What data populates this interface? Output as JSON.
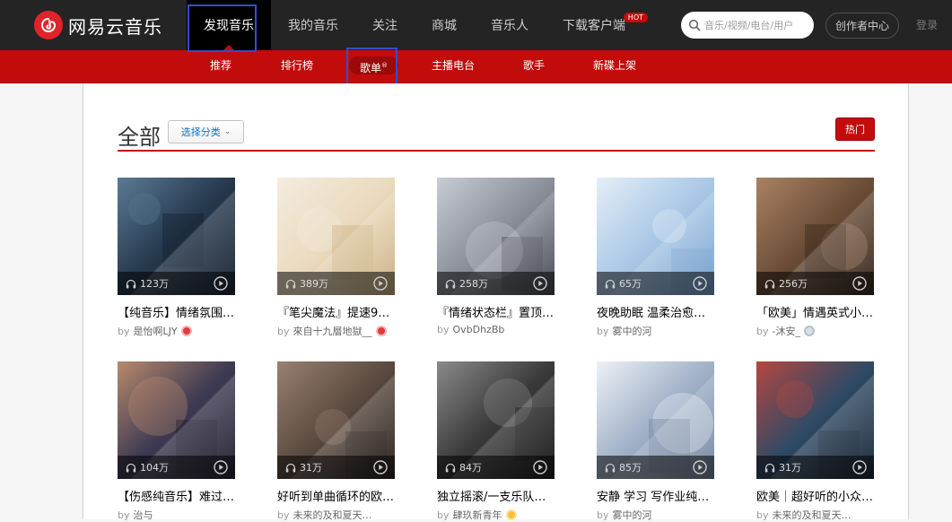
{
  "app": {
    "logo_text": "网易云音乐"
  },
  "nav": {
    "items": [
      {
        "label": "发现音乐"
      },
      {
        "label": "我的音乐"
      },
      {
        "label": "关注"
      },
      {
        "label": "商城"
      },
      {
        "label": "音乐人"
      },
      {
        "label": "下载客户端",
        "badge": "HOT"
      }
    ]
  },
  "search": {
    "placeholder": "音乐/视频/电台/用户"
  },
  "header_actions": {
    "creator_center": "创作者中心",
    "login": "登录"
  },
  "subnav": {
    "items": [
      {
        "label": "推荐"
      },
      {
        "label": "排行榜"
      },
      {
        "label": "歌单",
        "sup": "®"
      },
      {
        "label": "主播电台"
      },
      {
        "label": "歌手"
      },
      {
        "label": "新碟上架"
      }
    ]
  },
  "page": {
    "title": "全部",
    "category_button": "选择分类",
    "hot_button": "热门"
  },
  "playlists": [
    {
      "count": "123万",
      "title": "【纯音乐】情绪氛围…",
      "by": "by",
      "author": "是怡啊LJY",
      "badge": "red",
      "c1": "#25384c",
      "c2": "#0f1b29",
      "c3": "#5a7a95"
    },
    {
      "count": "389万",
      "title": "『笔尖魔法』提速9…",
      "by": "by",
      "author": "來自十九層地獄__",
      "badge": "red",
      "c1": "#eadbbd",
      "c2": "#c6a979",
      "c3": "#f4ece0"
    },
    {
      "count": "258万",
      "title": "『情绪状态栏』置顶…",
      "by": "by",
      "author": "OvbDhzBb",
      "badge": "",
      "c1": "#8a8f99",
      "c2": "#3b3f49",
      "c3": "#c8ccd3"
    },
    {
      "count": "65万",
      "title": "夜晚助眠 温柔治愈…",
      "by": "by",
      "author": "雾中的河",
      "badge": "",
      "c1": "#a9c8e6",
      "c2": "#6f9ccb",
      "c3": "#e5eef7"
    },
    {
      "count": "256万",
      "title": "「欧美」情遇英式小…",
      "by": "by",
      "author": "-沐安_",
      "badge": "gray",
      "c1": "#6b4d36",
      "c2": "#2b1d14",
      "c3": "#a98263"
    },
    {
      "count": "104万",
      "title": "【伤感纯音乐】难过…",
      "by": "by",
      "author": "治与",
      "badge": "",
      "c1": "#3d3a52",
      "c2": "#1a1826",
      "c3": "#b98a6c"
    },
    {
      "count": "31万",
      "title": "好听到单曲循环的欧…",
      "by": "by",
      "author": "未来的及和夏天…",
      "badge": "",
      "c1": "#5a4a40",
      "c2": "#1e1612",
      "c3": "#9a8070"
    },
    {
      "count": "84万",
      "title": "独立摇滚/一支乐队…",
      "by": "by",
      "author": "肆玖新青年",
      "badge": "gold",
      "c1": "#3a3a3a",
      "c2": "#111111",
      "c3": "#8a8a8a"
    },
    {
      "count": "85万",
      "title": "安静 学习 写作业纯…",
      "by": "by",
      "author": "雾中的河",
      "badge": "",
      "c1": "#9fb0c7",
      "c2": "#6c7f9b",
      "c3": "#eef1f5"
    },
    {
      "count": "31万",
      "title": "欧美｜超好听的小众…",
      "by": "by",
      "author": "未来的及和夏天…",
      "badge": "",
      "c1": "#2f4a66",
      "c2": "#0f1c2b",
      "c3": "#b5473f"
    }
  ]
}
